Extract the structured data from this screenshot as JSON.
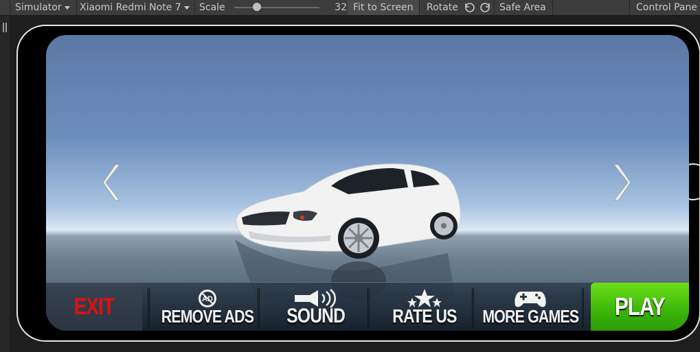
{
  "toolbar": {
    "simulator_label": "Simulator",
    "device_label": "Xiaomi Redmi Note 7",
    "scale_label": "Scale",
    "scale_value": "32",
    "fit_to_screen_label": "Fit to Screen",
    "rotate_label": "Rotate",
    "safe_area_label": "Safe Area",
    "control_panel_label": "Control Pane"
  },
  "game": {
    "menu": {
      "exit_label": "EXIT",
      "remove_ads_label": "REMOVE ADS",
      "remove_ads_icon_text": "AD",
      "sound_label": "SOUND",
      "rate_us_label": "RATE US",
      "more_games_label": "MORE GAMES",
      "play_label": "PLAY"
    },
    "colors": {
      "exit": "#e01010",
      "play": "#3db809"
    },
    "icons": {
      "prev": "chevron-left-icon",
      "next": "chevron-right-icon",
      "remove_ads": "no-ads-icon",
      "sound": "speaker-icon",
      "rate_us": "stars-icon",
      "more_games": "gamepad-icon"
    }
  }
}
